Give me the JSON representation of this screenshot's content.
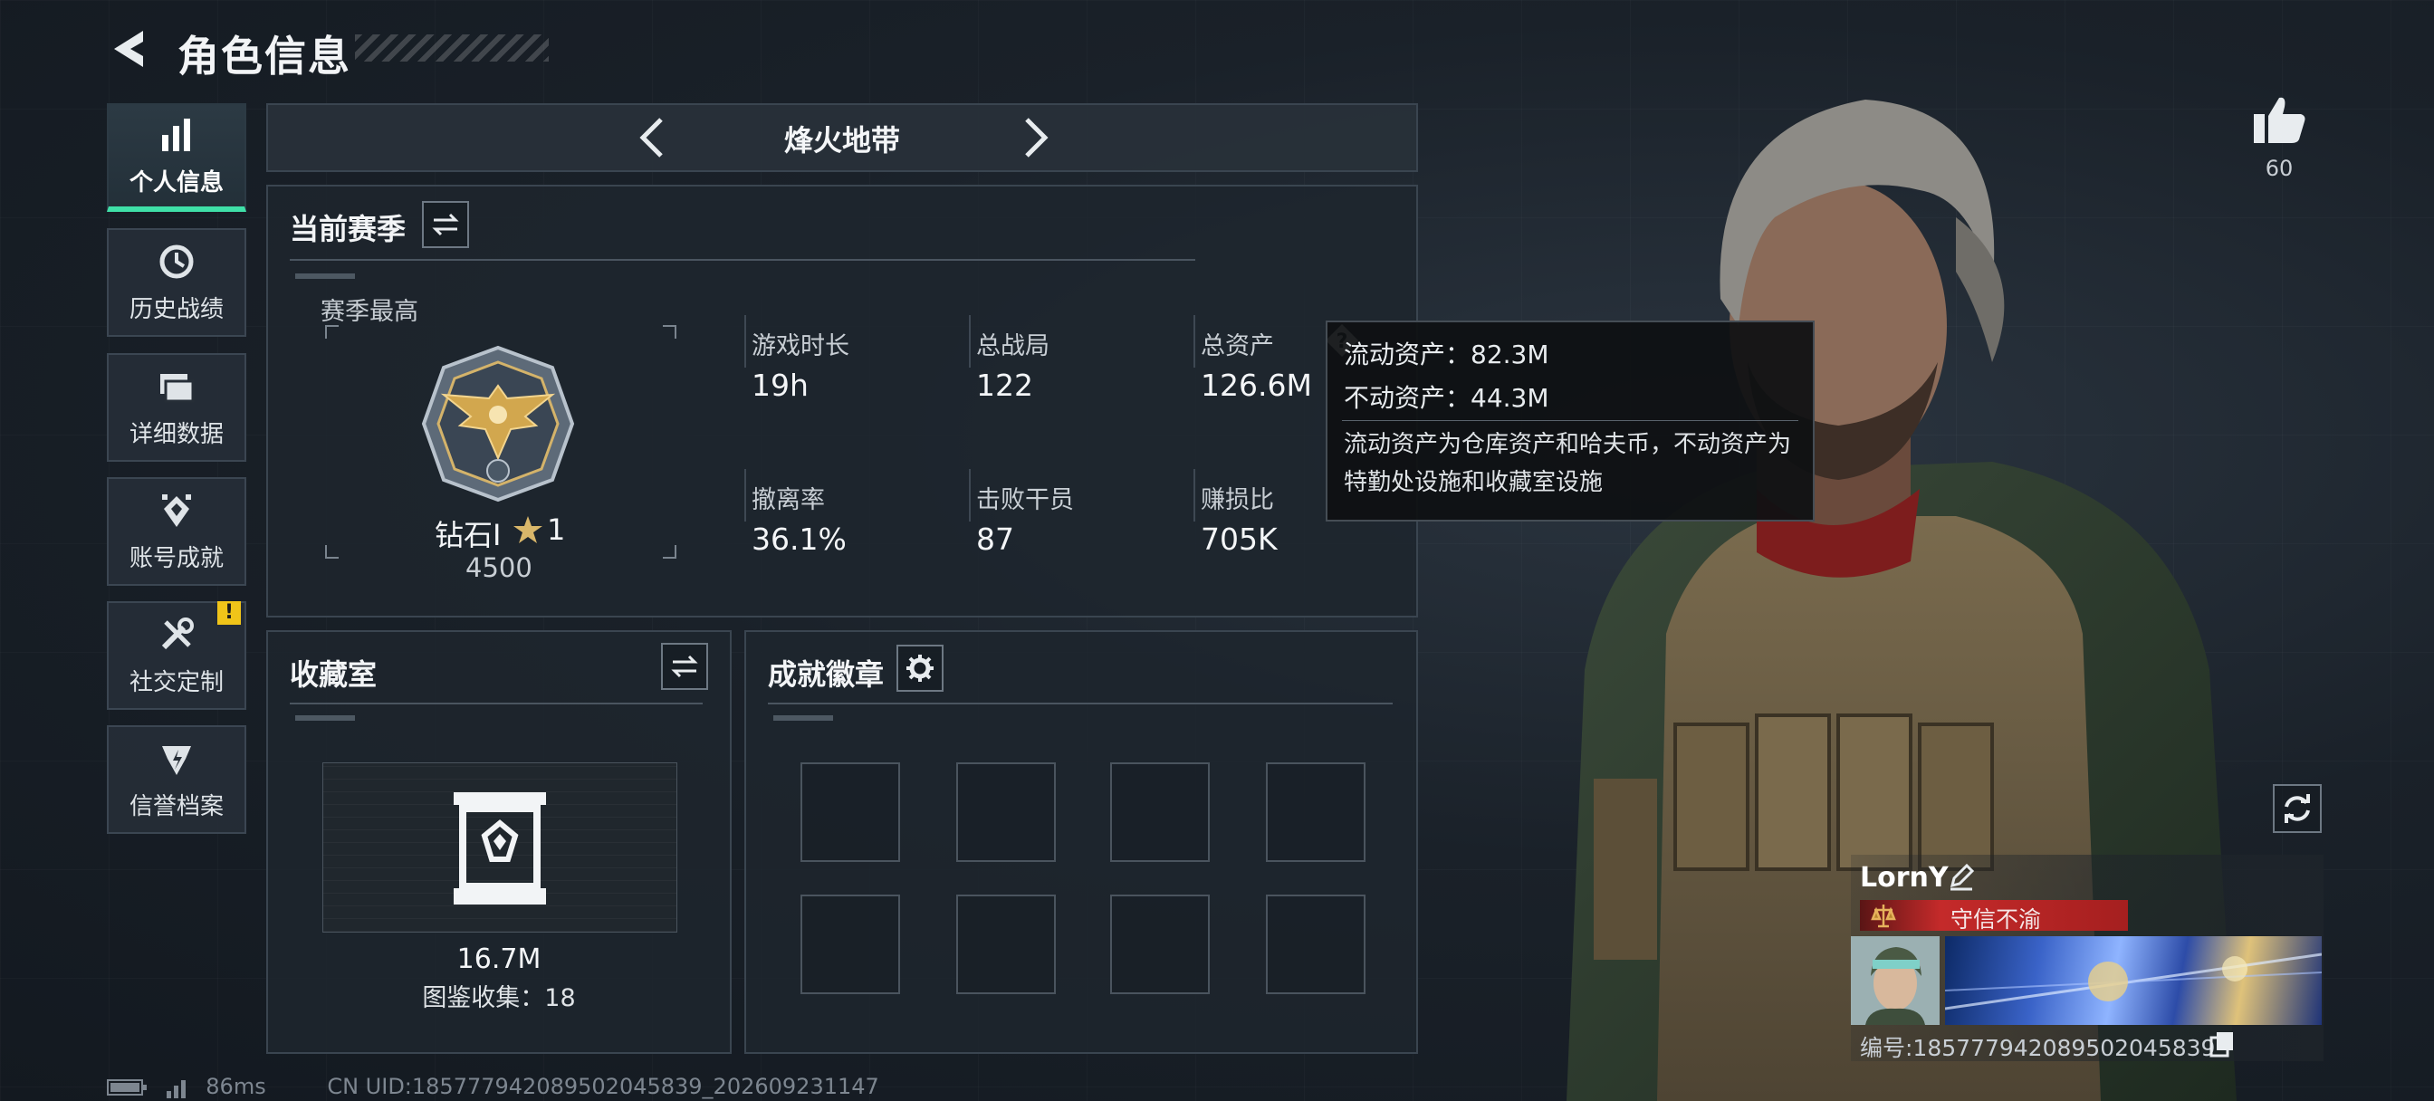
{
  "header": {
    "title": "角色信息"
  },
  "sidebar": {
    "items": [
      {
        "label": "个人信息",
        "icon": "bar-chart-icon",
        "active": true
      },
      {
        "label": "历史战绩",
        "icon": "history-clock-icon"
      },
      {
        "label": "详细数据",
        "icon": "folder-stack-icon"
      },
      {
        "label": "账号成就",
        "icon": "achievement-diamond-icon"
      },
      {
        "label": "社交定制",
        "icon": "wrench-tools-icon",
        "badge": "!"
      },
      {
        "label": "信誉档案",
        "icon": "reputation-emblem-icon"
      }
    ]
  },
  "mode_selector": {
    "name": "烽火地带"
  },
  "season": {
    "title": "当前赛季",
    "best_label": "赛季最高",
    "rank": "钻石Ⅰ",
    "stars": "1",
    "score": "4500",
    "stats": [
      {
        "label": "游戏时长",
        "value": "19h"
      },
      {
        "label": "总战局",
        "value": "122"
      },
      {
        "label": "总资产",
        "value": "126.6M"
      },
      {
        "label": "撤离率",
        "value": "36.1%"
      },
      {
        "label": "击败干员",
        "value": "87"
      },
      {
        "label": "赚损比",
        "value": "705K"
      }
    ]
  },
  "asset_tooltip": {
    "liquid": "流动资产：82.3M",
    "fixed": "不动资产：44.3M",
    "description": "流动资产为仓库资产和哈夫币，不动资产为特勤处设施和收藏室设施"
  },
  "collection": {
    "title": "收藏室",
    "value": "16.7M",
    "catalog": "图鉴收集：18"
  },
  "badges": {
    "title": "成就徽章",
    "slots": 8
  },
  "likes": {
    "count": "60"
  },
  "player": {
    "name": "LornY",
    "title": "守信不渝",
    "id": "编号:18577794208950204583​9"
  },
  "footer": {
    "ping": "86ms",
    "uid": "CN UID:1857779420895020458​39_202609231147"
  },
  "colors": {
    "accent": "#3fe0a8",
    "warning": "#f0c419",
    "title_red": "#c42a2a"
  }
}
